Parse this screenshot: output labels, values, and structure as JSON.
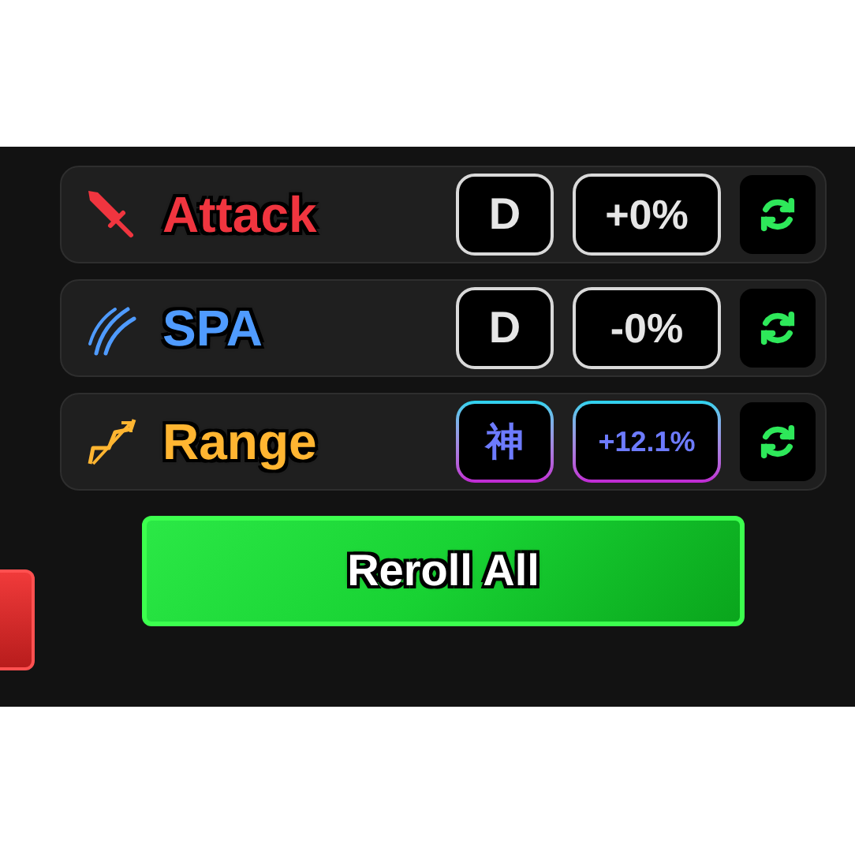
{
  "stats": [
    {
      "kind": "sword",
      "name": "Attack",
      "color": "#f0353f",
      "grade": "D",
      "divine": false,
      "value": "+0%"
    },
    {
      "kind": "claw",
      "name": "SPA",
      "color": "#4f9bff",
      "grade": "D",
      "divine": false,
      "value": "-0%"
    },
    {
      "kind": "bow",
      "name": "Range",
      "color": "#ffb531",
      "grade": "神",
      "divine": true,
      "value": "+12.1%"
    }
  ],
  "reroll_all": {
    "label": "Reroll All"
  }
}
